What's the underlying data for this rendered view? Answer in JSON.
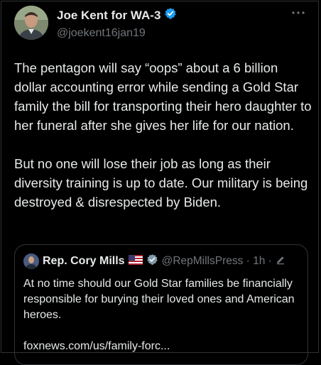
{
  "tweet": {
    "author": {
      "display_name": "Joe Kent for WA-3",
      "handle": "@joekent16jan19",
      "verified": true,
      "verified_badge_color": "#1d9bf0"
    },
    "paragraphs": [
      "The pentagon will say “oops” about a 6 billion dollar accounting error while sending a Gold Star family the bill for transporting their hero daughter to her funeral after she gives her life for our nation.",
      "But no one will lose their job as long as their diversity training is up to date. Our military is being destroyed & disrespected by Biden."
    ],
    "more_icon": "more-horizontal-icon"
  },
  "quoted_tweet": {
    "author": {
      "display_name": "Rep. Cory Mills",
      "flag_icon": "us-flag-icon",
      "badge_icon": "gray-verified-badge-icon",
      "handle_time": "@RepMillsPress · 1h ·"
    },
    "paragraphs": [
      "At no time should our Gold Star families be financially responsible for burying their loved ones and American heroes.",
      "foxnews.com/us/family-forc..."
    ],
    "edited_icon": "pencil-icon"
  }
}
